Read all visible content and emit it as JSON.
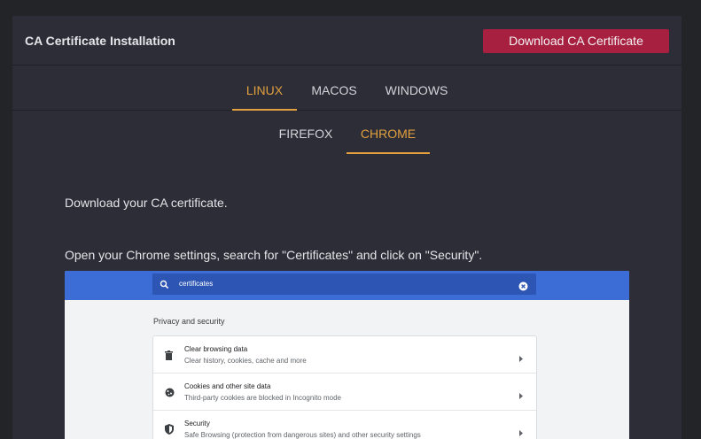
{
  "header": {
    "title": "CA Certificate Installation",
    "download_label": "Download CA Certificate"
  },
  "os_tabs": [
    {
      "label": "LINUX",
      "active": true
    },
    {
      "label": "MACOS",
      "active": false
    },
    {
      "label": "WINDOWS",
      "active": false
    }
  ],
  "browser_tabs": [
    {
      "label": "FIREFOX",
      "active": false
    },
    {
      "label": "CHROME",
      "active": true
    }
  ],
  "instructions": {
    "step1": "Download your CA certificate.",
    "step2": "Open your Chrome settings, search for \"Certificates\" and click on \"Security\"."
  },
  "screenshot": {
    "search_value": "certificates",
    "section_title": "Privacy and security",
    "rows": [
      {
        "title": "Clear browsing data",
        "subtitle": "Clear history, cookies, cache and more",
        "icon": "trash-icon"
      },
      {
        "title": "Cookies and other site data",
        "subtitle": "Third-party cookies are blocked in Incognito mode",
        "icon": "cookie-icon"
      },
      {
        "title": "Security",
        "subtitle": "Safe Browsing (protection from dangerous sites) and other security settings",
        "icon": "shield-icon"
      }
    ]
  },
  "colors": {
    "accent": "#e2a03f",
    "button": "#a8203f",
    "panel": "#2c2d36",
    "chrome_blue": "#3c6cd6"
  }
}
